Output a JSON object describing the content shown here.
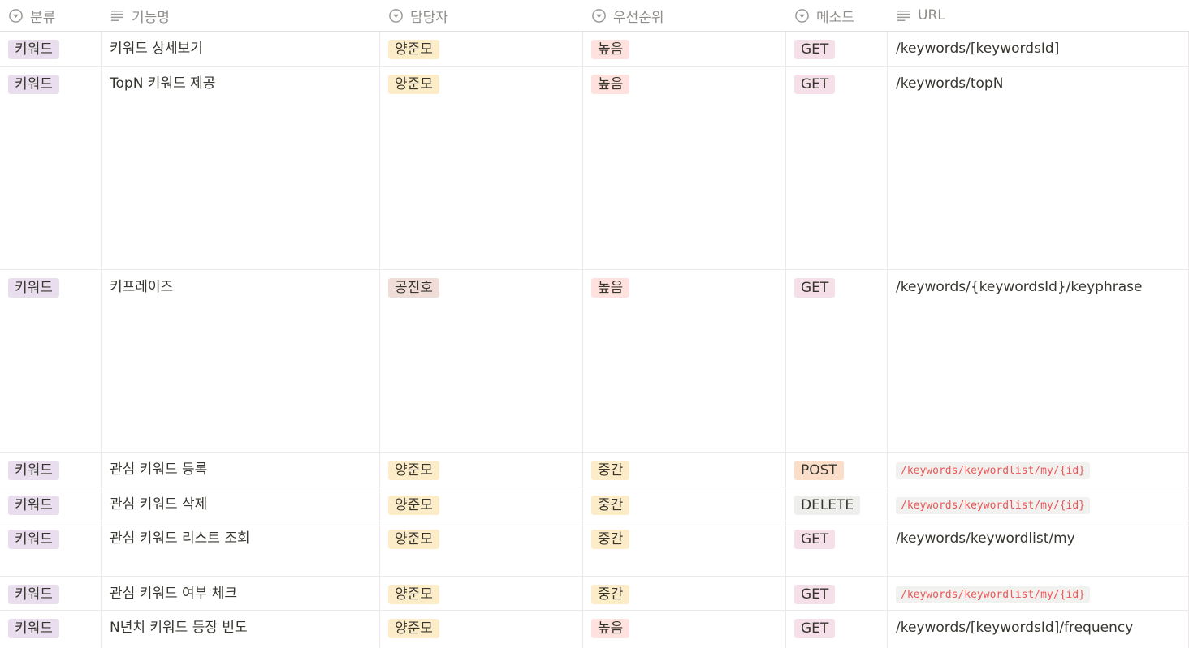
{
  "headers": {
    "category": "분류",
    "feature": "기능명",
    "owner": "담당자",
    "priority": "우선순위",
    "method": "메소드",
    "url": "URL"
  },
  "colors": {
    "category_bg": "#e8deee",
    "owner_yang_bg": "#fdecc8",
    "owner_gong_bg": "#f0ddd8",
    "priority_high_bg": "#ffe2dd",
    "priority_mid_bg": "#fdecc8",
    "method_get_bg": "#f5e0e9",
    "method_post_bg": "#fadec9",
    "method_delete_bg": "#efefed",
    "code_color": "#eb5757"
  },
  "rows": [
    {
      "category": "키워드",
      "feature": "키워드 상세보기",
      "owner": "양준모",
      "priority": "높음",
      "method": "GET",
      "url": "/keywords/[keywordsId]",
      "url_code": false
    },
    {
      "category": "키워드",
      "feature": "TopN 키워드 제공",
      "owner": "양준모",
      "priority": "높음",
      "method": "GET",
      "url": "/keywords/topN",
      "url_code": false
    },
    {
      "category": "키워드",
      "feature": "키프레이즈",
      "owner": "공진호",
      "priority": "높음",
      "method": "GET",
      "url": "/keywords/{keywordsId}/keyphrase",
      "url_code": false
    },
    {
      "category": "키워드",
      "feature": "관심 키워드 등록",
      "owner": "양준모",
      "priority": "중간",
      "method": "POST",
      "url": "/keywords/keywordlist/my/{id}",
      "url_code": true
    },
    {
      "category": "키워드",
      "feature": "관심 키워드 삭제",
      "owner": "양준모",
      "priority": "중간",
      "method": "DELETE",
      "url": "/keywords/keywordlist/my/{id}",
      "url_code": true
    },
    {
      "category": "키워드",
      "feature": "관심 키워드 리스트 조회",
      "owner": "양준모",
      "priority": "중간",
      "method": "GET",
      "url": "/keywords/keywordlist/my",
      "url_code": false
    },
    {
      "category": "키워드",
      "feature": "관심 키워드 여부 체크",
      "owner": "양준모",
      "priority": "중간",
      "method": "GET",
      "url": "/keywords/keywordlist/my/{id}",
      "url_code": true
    },
    {
      "category": "키워드",
      "feature": "N년치 키워드 등장 빈도",
      "owner": "양준모",
      "priority": "높음",
      "method": "GET",
      "url": "/keywords/[keywordsId]/frequency",
      "url_code": false
    }
  ]
}
